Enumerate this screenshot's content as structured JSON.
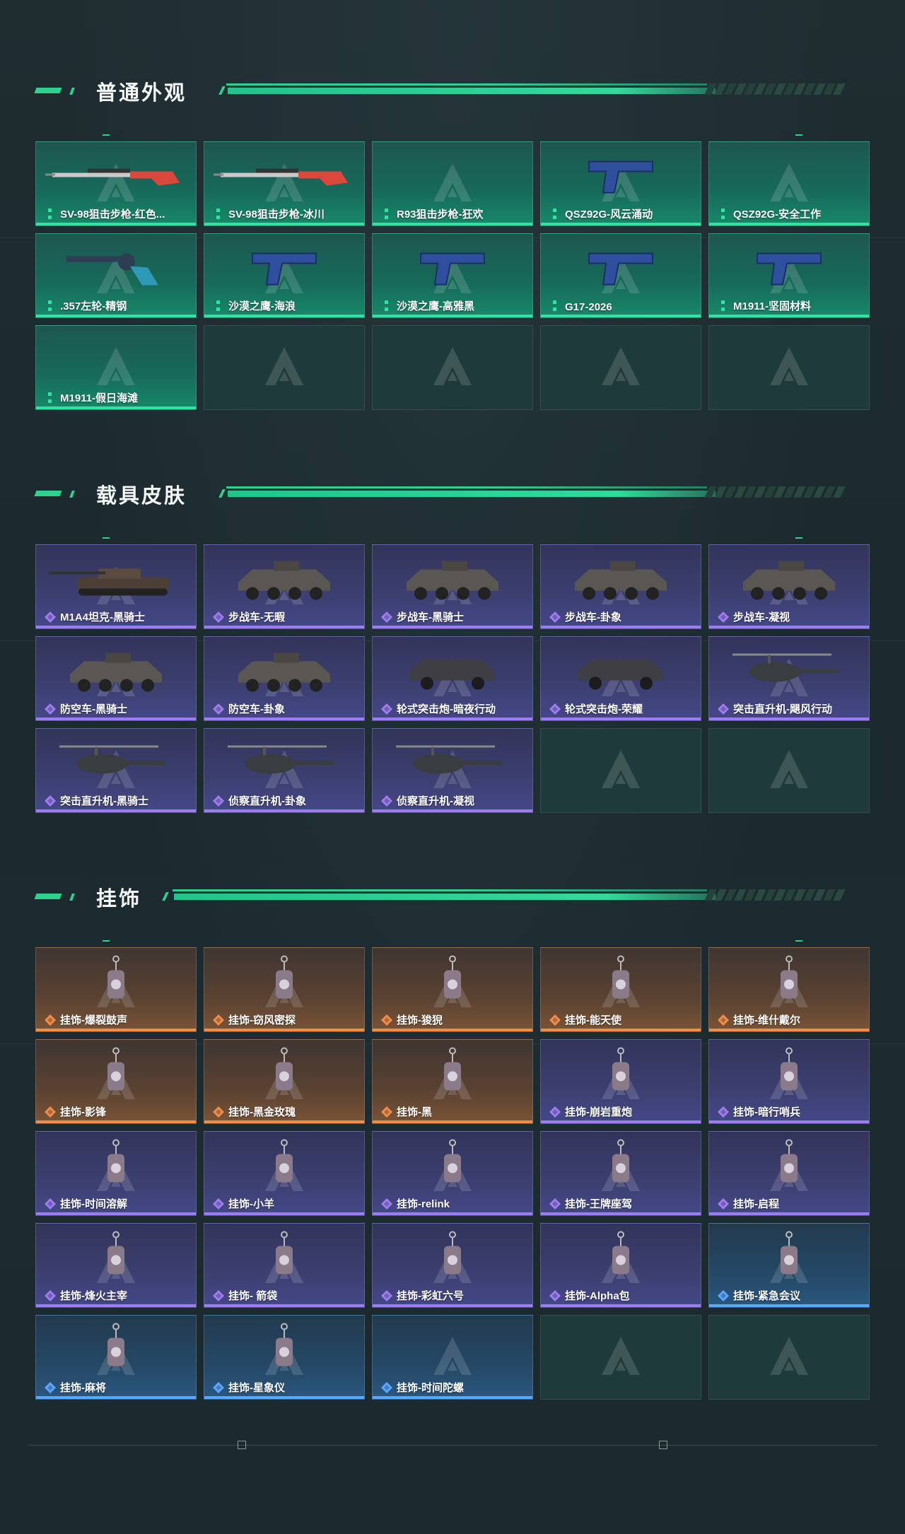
{
  "sections": [
    {
      "title": "普通外观",
      "rarity_color": "#34e2a0",
      "items": [
        {
          "label": "SV-98狙击步枪-红色...",
          "icon": "sniper-rifle-icon",
          "theme": "green"
        },
        {
          "label": "SV-98狙击步枪-冰川",
          "icon": "sniper-rifle-icon",
          "theme": "green"
        },
        {
          "label": "R93狙击步枪-狂欢",
          "icon": "",
          "theme": "green"
        },
        {
          "label": "QSZ92G-风云涌动",
          "icon": "pistol-icon",
          "theme": "green"
        },
        {
          "label": "QSZ92G-安全工作",
          "icon": "",
          "theme": "green"
        },
        {
          "label": ".357左轮-精钢",
          "icon": "revolver-icon",
          "theme": "green"
        },
        {
          "label": "沙漠之鹰-海浪",
          "icon": "pistol-icon",
          "theme": "green"
        },
        {
          "label": "沙漠之鹰-高雅黑",
          "icon": "pistol-icon",
          "theme": "green"
        },
        {
          "label": "G17-2026",
          "icon": "pistol-icon",
          "theme": "green"
        },
        {
          "label": "M1911-坚固材料",
          "icon": "pistol-icon",
          "theme": "green"
        },
        {
          "label": "M1911-假日海滩",
          "icon": "",
          "theme": "green"
        },
        {
          "label": "",
          "icon": "",
          "theme": "empty"
        },
        {
          "label": "",
          "icon": "",
          "theme": "empty"
        },
        {
          "label": "",
          "icon": "",
          "theme": "empty"
        },
        {
          "label": "",
          "icon": "",
          "theme": "empty"
        }
      ]
    },
    {
      "title": "载具皮肤",
      "rarity_color": "#9d7cf0",
      "items": [
        {
          "label": "M1A4坦克-黑骑士",
          "icon": "tank-icon",
          "theme": "purple"
        },
        {
          "label": "步战车-无暇",
          "icon": "ifv-icon",
          "theme": "purple"
        },
        {
          "label": "步战车-黑骑士",
          "icon": "ifv-icon",
          "theme": "purple"
        },
        {
          "label": "步战车-卦象",
          "icon": "ifv-icon",
          "theme": "purple"
        },
        {
          "label": "步战车-凝视",
          "icon": "ifv-icon",
          "theme": "purple"
        },
        {
          "label": "防空车-黑骑士",
          "icon": "ifv-icon",
          "theme": "purple"
        },
        {
          "label": "防空车-卦象",
          "icon": "ifv-icon",
          "theme": "purple"
        },
        {
          "label": "轮式突击炮-暗夜行动",
          "icon": "armored-car-icon",
          "theme": "purple"
        },
        {
          "label": "轮式突击炮-荣耀",
          "icon": "armored-car-icon",
          "theme": "purple"
        },
        {
          "label": "突击直升机-飓风行动",
          "icon": "helicopter-icon",
          "theme": "purple"
        },
        {
          "label": "突击直升机-黑骑士",
          "icon": "helicopter-icon",
          "theme": "purple"
        },
        {
          "label": "侦察直升机-卦象",
          "icon": "helicopter-icon",
          "theme": "purple"
        },
        {
          "label": "侦察直升机-凝视",
          "icon": "helicopter-icon",
          "theme": "purple"
        },
        {
          "label": "",
          "icon": "",
          "theme": "empty"
        },
        {
          "label": "",
          "icon": "",
          "theme": "empty"
        }
      ]
    },
    {
      "title": "挂饰",
      "rarity_color": "#ef8d4a",
      "items": [
        {
          "label": "挂饰-爆裂鼓声",
          "icon": "charm-icon",
          "theme": "orange"
        },
        {
          "label": "挂饰-窃风密探",
          "icon": "charm-icon",
          "theme": "orange"
        },
        {
          "label": "挂饰-狻猊",
          "icon": "charm-icon",
          "theme": "orange"
        },
        {
          "label": "挂饰-能天使",
          "icon": "charm-icon",
          "theme": "orange"
        },
        {
          "label": "挂饰-维什戴尔",
          "icon": "charm-icon",
          "theme": "orange"
        },
        {
          "label": "挂饰-影锋",
          "icon": "charm-icon",
          "theme": "orange"
        },
        {
          "label": "挂饰-黑金玫瑰",
          "icon": "charm-icon",
          "theme": "orange"
        },
        {
          "label": "挂饰-黑",
          "icon": "charm-icon",
          "theme": "orange"
        },
        {
          "label": "挂饰-崩岩重炮",
          "icon": "charm-icon",
          "theme": "purple"
        },
        {
          "label": "挂饰-暗行哨兵",
          "icon": "charm-icon",
          "theme": "purple"
        },
        {
          "label": "挂饰-时间溶解",
          "icon": "charm-icon",
          "theme": "purple"
        },
        {
          "label": "挂饰-小羊",
          "icon": "charm-icon",
          "theme": "purple"
        },
        {
          "label": "挂饰-relink",
          "icon": "charm-icon",
          "theme": "purple"
        },
        {
          "label": "挂饰-王牌座驾",
          "icon": "charm-icon",
          "theme": "purple"
        },
        {
          "label": "挂饰-启程",
          "icon": "charm-icon",
          "theme": "purple"
        },
        {
          "label": "挂饰-烽火主宰",
          "icon": "charm-icon",
          "theme": "purple"
        },
        {
          "label": "挂饰- 箭袋",
          "icon": "charm-icon",
          "theme": "purple"
        },
        {
          "label": "挂饰-彩虹六号",
          "icon": "charm-icon",
          "theme": "purple"
        },
        {
          "label": "挂饰-Alpha包",
          "icon": "charm-icon",
          "theme": "purple"
        },
        {
          "label": "挂饰-紧急会议",
          "icon": "charm-icon",
          "theme": "blue"
        },
        {
          "label": "挂饰-麻将",
          "icon": "charm-icon",
          "theme": "blue"
        },
        {
          "label": "挂饰-星象仪",
          "icon": "charm-icon",
          "theme": "blue"
        },
        {
          "label": "挂饰-时间陀螺",
          "icon": "",
          "theme": "blue"
        },
        {
          "label": "",
          "icon": "",
          "theme": "empty"
        },
        {
          "label": "",
          "icon": "",
          "theme": "empty"
        }
      ]
    }
  ],
  "colors": {
    "accent": "#2fd28c",
    "green_card": "#176a5b",
    "purple_card": "#3c3f70",
    "orange_card": "#5a4232",
    "blue_card": "#254866",
    "empty_card": "#1e3a3a"
  }
}
